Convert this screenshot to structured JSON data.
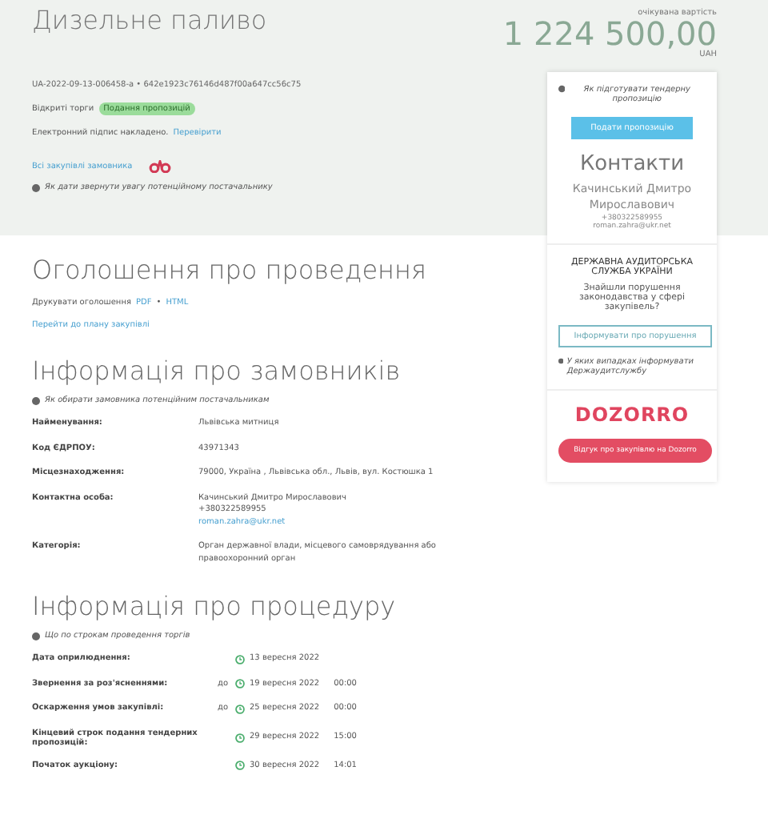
{
  "header": {
    "title": "Дизельне паливо",
    "tender_id": "UA-2022-09-13-006458-a • 642e1923c76146d487f00a647cc56c75",
    "status_label": "Відкриті торги",
    "status_badge": "Подання пропозицій",
    "signature_text": "Електронний підпис накладено.",
    "signature_link": "Перевірити",
    "all_purchases_link": "Всі закупівлі замовника",
    "attention_hint": "Як дати звернути увагу потенційному постачальнику"
  },
  "value": {
    "caption": "очікувана вартість",
    "amount": "1 224 500,00",
    "currency": "UAH"
  },
  "sidebar": {
    "hint": "Як підготувати тендерну пропозицію",
    "submit_button": "Подати пропозицію",
    "contacts_title": "Контакти",
    "contact_name": "Качинський Дмитро Мирославович",
    "contact_phone": "+380322589955",
    "contact_email": "roman.zahra@ukr.net",
    "audit_title": "ДЕРЖАВНА АУДИТОРСЬКА СЛУЖБА УКРАЇНИ",
    "audit_question": "Знайшли порушення законодавства у сфері закупівель?",
    "audit_button": "Інформувати про порушення",
    "audit_hint": "У яких випадках інформувати Держаудитслужбу",
    "dozorro_logo": "DOZORRO",
    "dozorro_button": "Відгук про закупівлю на Dozorro"
  },
  "announcement": {
    "title": "Оголошення про проведення",
    "print_text": "Друкувати оголошення",
    "pdf_link": "PDF",
    "separator": "•",
    "html_link": "HTML",
    "plan_link": "Перейти до плану закупівлі"
  },
  "customer": {
    "title": "Інформація про замовників",
    "hint": "Як обирати замовника потенційним постачальникам",
    "rows": [
      {
        "label": "Найменування:",
        "lines": [
          "Львівська митниця"
        ]
      },
      {
        "label": "Код ЄДРПОУ:",
        "lines": [
          "43971343"
        ]
      },
      {
        "label": "Місцезнаходження:",
        "lines": [
          "79000, Україна , Львівська обл., Львів, вул. Костюшка 1"
        ]
      },
      {
        "label": "Контактна особа:",
        "lines": [
          "Качинський Дмитро Мирославович",
          "+380322589955"
        ],
        "link": "roman.zahra@ukr.net"
      },
      {
        "label": "Категорія:",
        "lines": [
          "Орган державної влади, місцевого самоврядування або правоохоронний орган"
        ]
      }
    ]
  },
  "procedure": {
    "title": "Інформація про процедуру",
    "hint": "Що по строкам проведення торгів",
    "rows": [
      {
        "label": "Дата оприлюднення:",
        "prefix": "",
        "date": "13 вересня 2022",
        "time": ""
      },
      {
        "label": "Звернення за роз'ясненнями:",
        "prefix": "до",
        "date": "19 вересня 2022",
        "time": "00:00"
      },
      {
        "label": "Оскарження умов закупівлі:",
        "prefix": "до",
        "date": "25 вересня 2022",
        "time": "00:00"
      },
      {
        "label": "Кінцевий строк подання тендерних пропозицій:",
        "prefix": "",
        "date": "29 вересня 2022",
        "time": "15:00"
      },
      {
        "label": "Початок аукціону:",
        "prefix": "",
        "date": "30 вересня 2022",
        "time": "14:01"
      }
    ]
  }
}
